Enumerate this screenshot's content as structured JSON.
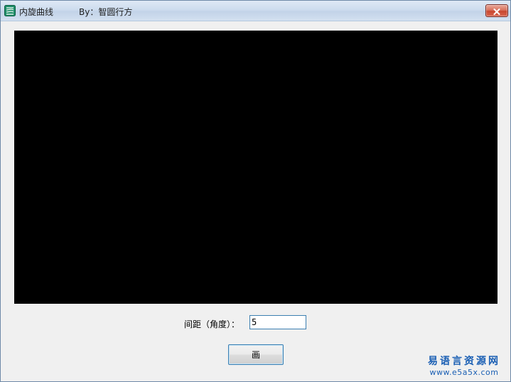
{
  "window": {
    "title": "内旋曲线",
    "author": "By：智圆行方"
  },
  "form": {
    "interval_label": "间距（角度）：",
    "interval_value": "5",
    "draw_button": "画"
  },
  "watermark": {
    "line1": "易语言资源网",
    "line2": "www.e5a5x.com"
  },
  "colors": {
    "canvas": "#000000",
    "window_bg": "#f0f0f0",
    "close_button": "#c8452e",
    "watermark": "#1a5fb4"
  }
}
